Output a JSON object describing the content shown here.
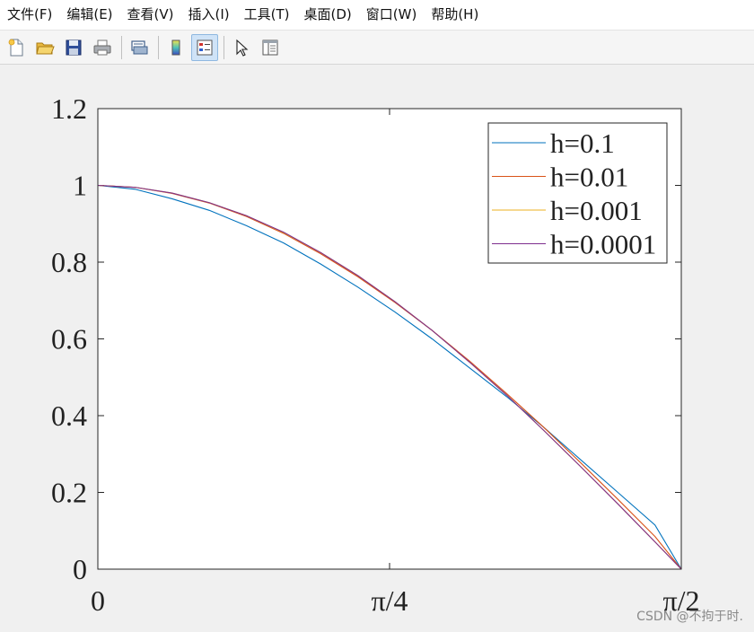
{
  "menu": [
    {
      "id": "file",
      "label": "文件(F)"
    },
    {
      "id": "edit",
      "label": "编辑(E)"
    },
    {
      "id": "view",
      "label": "查看(V)"
    },
    {
      "id": "insert",
      "label": "插入(I)"
    },
    {
      "id": "tools",
      "label": "工具(T)"
    },
    {
      "id": "desktop",
      "label": "桌面(D)"
    },
    {
      "id": "window",
      "label": "窗口(W)"
    },
    {
      "id": "help",
      "label": "帮助(H)"
    }
  ],
  "toolbar_icons": [
    "new-file-icon",
    "open-folder-icon",
    "save-icon",
    "print-icon",
    "print-preview-icon",
    "colorbar-icon",
    "legend-icon",
    "pointer-icon",
    "property-editor-icon"
  ],
  "watermark": "CSDN @不拘于时.",
  "chart_data": {
    "type": "line",
    "xlim": [
      0,
      1.5708
    ],
    "ylim": [
      0,
      1.2
    ],
    "x_ticks": [
      0,
      0.7854,
      1.5708
    ],
    "x_tick_labels": [
      "0",
      "π/4",
      "π/2"
    ],
    "y_ticks": [
      0,
      0.2,
      0.4,
      0.6,
      0.8,
      1.0,
      1.2
    ],
    "y_tick_labels": [
      "0",
      "0.2",
      "0.4",
      "0.6",
      "0.8",
      "1",
      "1.2"
    ],
    "grid": false,
    "legend_position": "top-right",
    "series": [
      {
        "name": "h=0.1",
        "color": "#0072BD",
        "x": [
          0,
          0.1,
          0.2,
          0.3,
          0.4,
          0.5,
          0.6,
          0.7,
          0.8,
          0.9,
          1.0,
          1.1,
          1.2,
          1.3,
          1.4,
          1.5,
          1.5708
        ],
        "y": [
          1.0,
          0.99,
          0.965,
          0.935,
          0.895,
          0.85,
          0.795,
          0.735,
          0.67,
          0.6,
          0.525,
          0.45,
          0.37,
          0.285,
          0.2,
          0.115,
          0.0
        ]
      },
      {
        "name": "h=0.01",
        "color": "#D95319",
        "x": [
          0,
          0.1,
          0.2,
          0.3,
          0.4,
          0.5,
          0.6,
          0.7,
          0.8,
          0.9,
          1.0,
          1.1,
          1.2,
          1.3,
          1.4,
          1.5,
          1.5708
        ],
        "y": [
          1.0,
          0.995,
          0.979,
          0.954,
          0.919,
          0.875,
          0.822,
          0.762,
          0.695,
          0.622,
          0.543,
          0.458,
          0.37,
          0.277,
          0.182,
          0.085,
          0.0
        ]
      },
      {
        "name": "h=0.001",
        "color": "#EDB120",
        "x": [
          0,
          0.1,
          0.2,
          0.3,
          0.4,
          0.5,
          0.6,
          0.7,
          0.8,
          0.9,
          1.0,
          1.1,
          1.2,
          1.3,
          1.4,
          1.5,
          1.5708
        ],
        "y": [
          1.0,
          0.995,
          0.98,
          0.955,
          0.921,
          0.877,
          0.825,
          0.765,
          0.697,
          0.622,
          0.54,
          0.454,
          0.362,
          0.267,
          0.17,
          0.071,
          0.0
        ]
      },
      {
        "name": "h=0.0001",
        "color": "#7E2F8E",
        "x": [
          0,
          0.1,
          0.2,
          0.3,
          0.4,
          0.5,
          0.6,
          0.7,
          0.8,
          0.9,
          1.0,
          1.1,
          1.2,
          1.3,
          1.4,
          1.5,
          1.5708
        ],
        "y": [
          1.0,
          0.995,
          0.98,
          0.955,
          0.921,
          0.878,
          0.825,
          0.765,
          0.697,
          0.622,
          0.54,
          0.454,
          0.362,
          0.267,
          0.17,
          0.071,
          0.0
        ]
      }
    ]
  }
}
